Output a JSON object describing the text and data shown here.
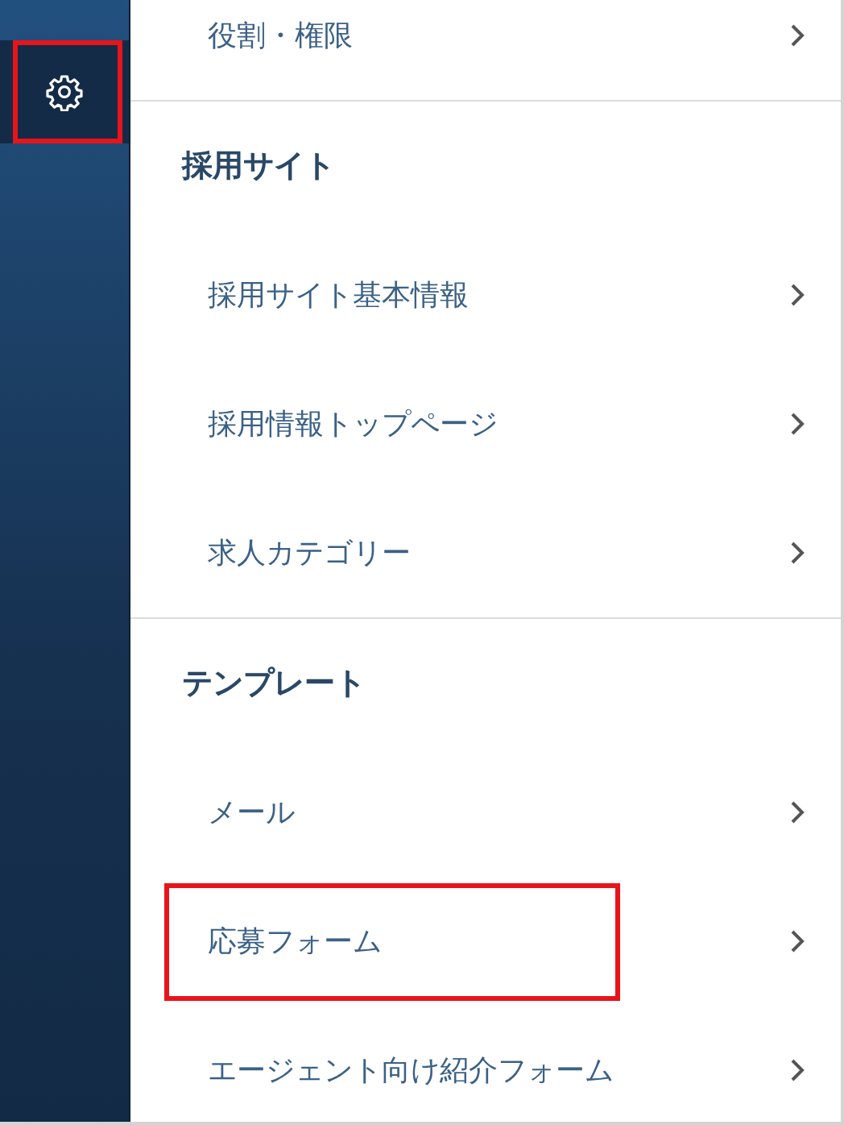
{
  "sidebar": {
    "settings_button": {
      "highlighted": true
    }
  },
  "menu": {
    "groups": [
      {
        "items": [
          {
            "label": "役割・権限",
            "highlighted": false
          }
        ]
      },
      {
        "heading": "採用サイト",
        "items": [
          {
            "label": "採用サイト基本情報",
            "highlighted": false
          },
          {
            "label": "採用情報トップページ",
            "highlighted": false
          },
          {
            "label": "求人カテゴリー",
            "highlighted": false
          }
        ]
      },
      {
        "heading": "テンプレート",
        "items": [
          {
            "label": "メール",
            "highlighted": false
          },
          {
            "label": "応募フォーム",
            "highlighted": true
          },
          {
            "label": "エージェント向け紹介フォーム",
            "highlighted": false
          }
        ]
      }
    ]
  }
}
